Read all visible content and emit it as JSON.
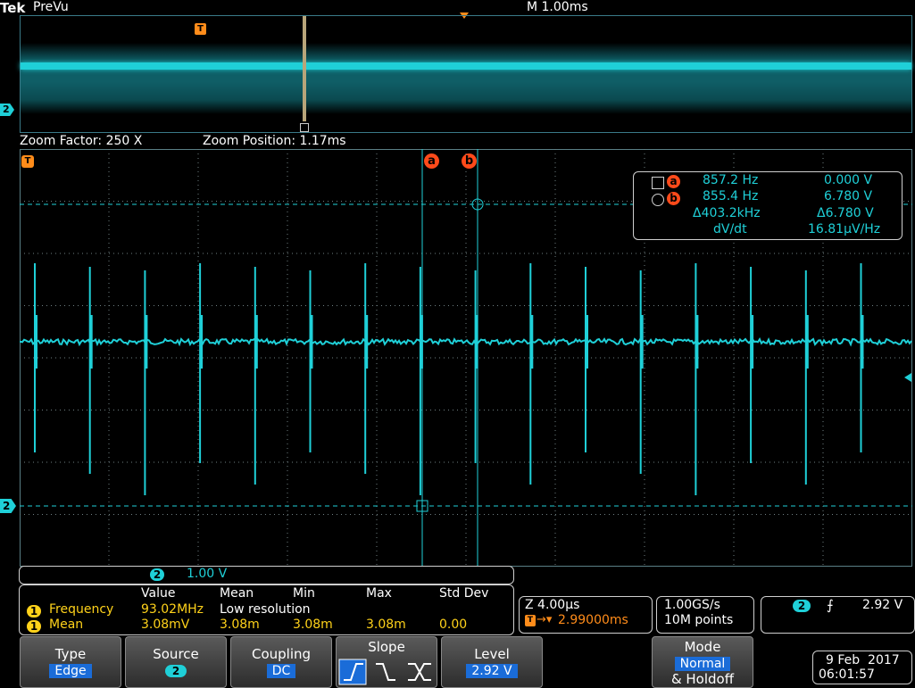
{
  "header": {
    "brand": "Tek",
    "mode": "PreVu",
    "timebase": "M 1.00ms"
  },
  "zoom": {
    "factor_label": "Zoom Factor: 250 X",
    "position_label": "Zoom Position: 1.17ms"
  },
  "markers": {
    "trigger_glyph": "T",
    "channel2_glyph": "2",
    "cursor_a": "a",
    "cursor_b": "b"
  },
  "cursor_readout": {
    "a_freq": "857.2 Hz",
    "a_volt": "0.000 V",
    "b_freq": "855.4 Hz",
    "b_volt": "6.780 V",
    "delta_freq": "Δ403.2kHz",
    "delta_volt": "Δ6.780 V",
    "dvdt_label": "dV/dt",
    "dvdt_value": "16.81µV/Hz"
  },
  "channel_scale": {
    "channel": "2",
    "scale": "1.00 V"
  },
  "measurements": {
    "headers": [
      "Value",
      "Mean",
      "Min",
      "Max",
      "Std Dev"
    ],
    "rows": [
      {
        "ch": "1",
        "name": "Frequency",
        "value": "93.02MHz",
        "mean": "Low resolution",
        "min": "",
        "max": "",
        "std": ""
      },
      {
        "ch": "1",
        "name": "Mean",
        "value": "3.08mV",
        "mean": "3.08m",
        "min": "3.08m",
        "max": "3.08m",
        "std": "0.00"
      }
    ]
  },
  "horizontal": {
    "zoom_time": "Z 4.00µs",
    "trigger_pos": "2.99000ms",
    "sample_rate": "1.00GS/s",
    "record_length": "10M points"
  },
  "trigger_readout": {
    "channel": "2",
    "level": "2.92 V"
  },
  "softkeys": {
    "type_label": "Type",
    "type_value": "Edge",
    "source_label": "Source",
    "source_value": "2",
    "coupling_label": "Coupling",
    "coupling_value": "DC",
    "slope_label": "Slope",
    "level_label": "Level",
    "level_value": "2.92 V",
    "mode_label": "Mode",
    "mode_value": "Normal",
    "mode_sub": "& Holdoff"
  },
  "datetime": {
    "date": "9 Feb  2017",
    "time": "06:01:57"
  },
  "colors": {
    "trace": "#1fd0d8",
    "cursor_badge": "#ff4a1a",
    "trigger_orange": "#ff8c1a",
    "ch1_yellow": "#ffd21a",
    "selected_blue": "#1a6cd8"
  }
}
